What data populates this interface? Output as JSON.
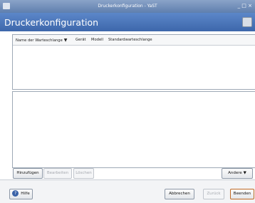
{
  "window": {
    "title": "Druckerkonfiguration - YaST",
    "controls": "_ □ ×"
  },
  "header": {
    "title": "Druckerkonfiguration"
  },
  "table": {
    "columns": [
      {
        "label": "Name der Warteschlange",
        "sorted": true
      },
      {
        "label": "Gerät"
      },
      {
        "label": "Modell"
      },
      {
        "label": "Standardwarteschlange"
      }
    ],
    "rows": []
  },
  "buttons": {
    "add": "Hinzufügen",
    "edit": "Bearbeiten",
    "delete": "Löschen",
    "other": "Andere"
  },
  "footer": {
    "help": "Hilfe",
    "cancel": "Abbrechen",
    "back": "Zurück",
    "finish": "Beenden"
  },
  "colors": {
    "header": "#4a74b7",
    "titlebar": "#6f8dbd"
  },
  "icons": {
    "help": "help-icon",
    "printer": "printer-icon"
  }
}
